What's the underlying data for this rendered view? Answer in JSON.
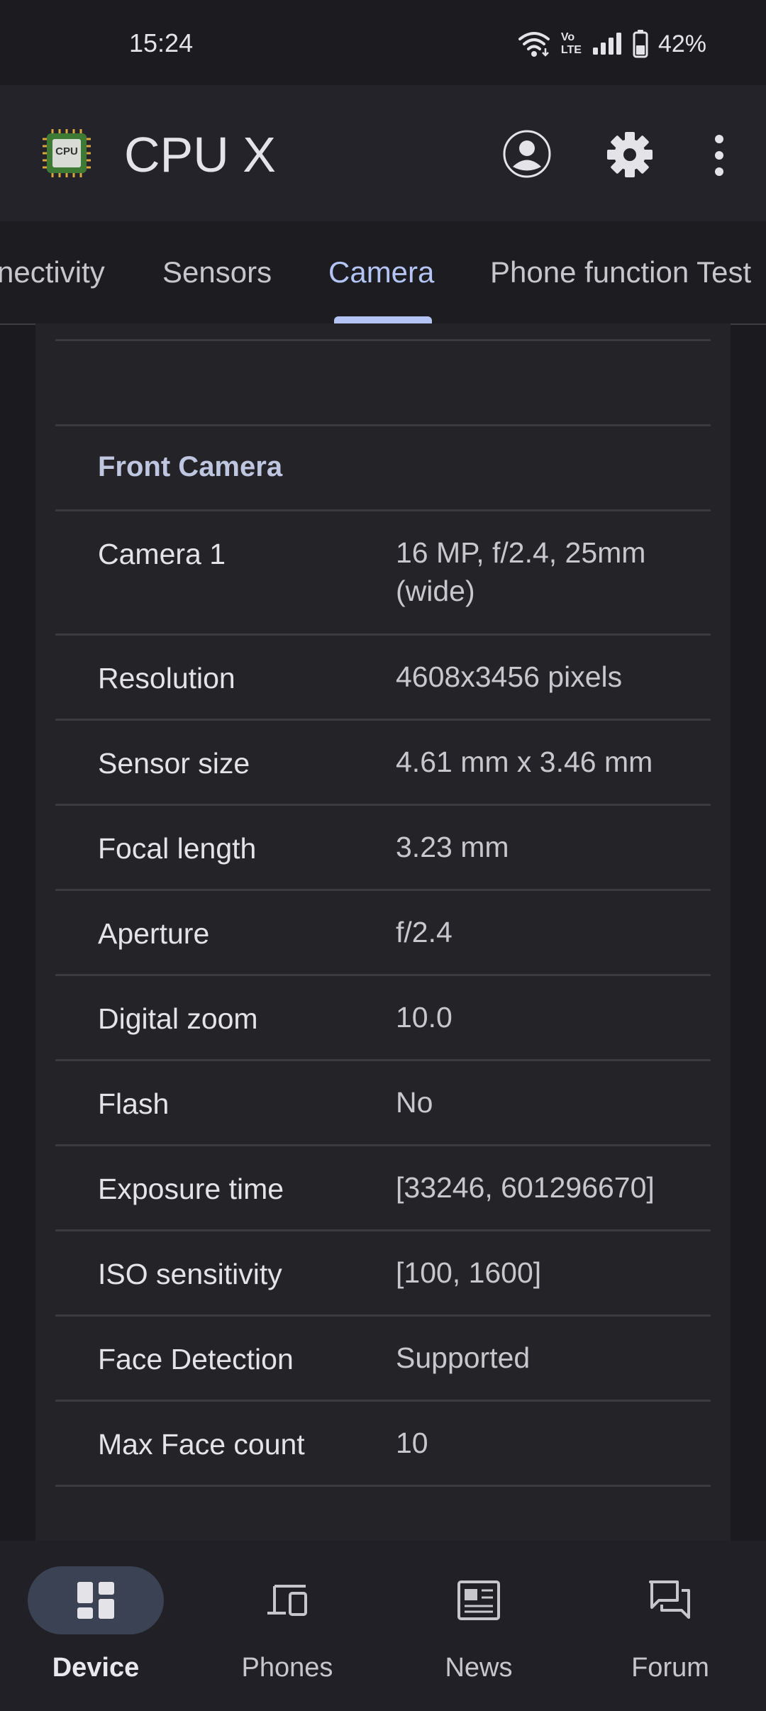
{
  "status_bar": {
    "time": "15:24",
    "volte_label_top": "Vo",
    "volte_label_bottom": "LTE",
    "battery_percent": "42%",
    "icons": [
      "wifi-icon",
      "volte-icon",
      "signal-icon",
      "battery-icon"
    ]
  },
  "app_bar": {
    "app_name": "CPU X",
    "logo_text": "CPU",
    "icons": [
      "account-icon",
      "settings-icon",
      "more-vert-icon"
    ]
  },
  "tabs": {
    "items": [
      {
        "label": "nectivity"
      },
      {
        "label": "Sensors"
      },
      {
        "label": "Camera"
      },
      {
        "label": "Phone function Test"
      }
    ],
    "active_index": 2
  },
  "section": {
    "title": "Front Camera",
    "rows": [
      {
        "label": "Camera 1",
        "value": "16 MP, f/2.4, 25mm (wide)"
      },
      {
        "label": "Resolution",
        "value": "4608x3456 pixels"
      },
      {
        "label": "Sensor size",
        "value": "4.61 mm x 3.46 mm"
      },
      {
        "label": "Focal length",
        "value": "3.23 mm"
      },
      {
        "label": "Aperture",
        "value": "f/2.4"
      },
      {
        "label": "Digital zoom",
        "value": "10.0"
      },
      {
        "label": "Flash",
        "value": "No"
      },
      {
        "label": "Exposure time",
        "value": "[33246, 601296670]"
      },
      {
        "label": "ISO sensitivity",
        "value": "[100, 1600]"
      },
      {
        "label": "Face Detection",
        "value": "Supported"
      },
      {
        "label": "Max Face count",
        "value": "10"
      }
    ]
  },
  "bottom_nav": {
    "items": [
      {
        "label": "Device",
        "icon": "dashboard-icon"
      },
      {
        "label": "Phones",
        "icon": "devices-icon"
      },
      {
        "label": "News",
        "icon": "newspaper-icon"
      },
      {
        "label": "Forum",
        "icon": "forum-icon"
      }
    ],
    "active_index": 0
  },
  "colors": {
    "background": "#1b1b1f",
    "accent": "#b4c4f5",
    "section_title": "#bec6e0",
    "nav_pill": "#3b4254"
  }
}
